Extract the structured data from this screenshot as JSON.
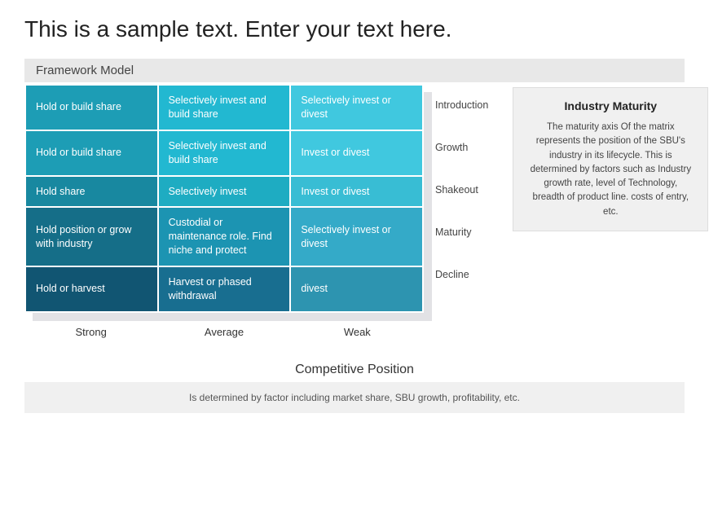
{
  "page": {
    "main_title": "This is a sample text. Enter your text here.",
    "framework_label": "Framework Model"
  },
  "matrix": {
    "rows": [
      {
        "id": "row1",
        "stage": "Introduction",
        "cells": [
          "Hold or build share",
          "Selectively invest and build share",
          "Selectively invest or divest"
        ]
      },
      {
        "id": "row2",
        "stage": "Growth",
        "cells": [
          "Hold or build share",
          "Selectively invest and build share",
          "Invest or divest"
        ]
      },
      {
        "id": "row3",
        "stage": "Shakeout",
        "cells": [
          "Hold share",
          "Selectively invest",
          "Invest or divest"
        ]
      },
      {
        "id": "row4",
        "stage": "Maturity",
        "cells": [
          "Hold position or grow with industry",
          "Custodial or maintenance role. Find niche and protect",
          "Selectively invest or divest"
        ]
      },
      {
        "id": "row5",
        "stage": "Decline",
        "cells": [
          "Hold or harvest",
          "Harvest or phased withdrawal",
          "divest"
        ]
      }
    ],
    "col_labels": [
      "Strong",
      "Average",
      "Weak"
    ]
  },
  "info_box": {
    "title": "Industry Maturity",
    "text": "The maturity axis Of the matrix represents the position of the SBU's industry in its lifecycle. This is determined by factors such as Industry growth rate, level of Technology, breadth of product line. costs of entry, etc."
  },
  "competitive": {
    "title": "Competitive Position",
    "text": "Is determined by factor including market share, SBU growth, profitability, etc."
  }
}
